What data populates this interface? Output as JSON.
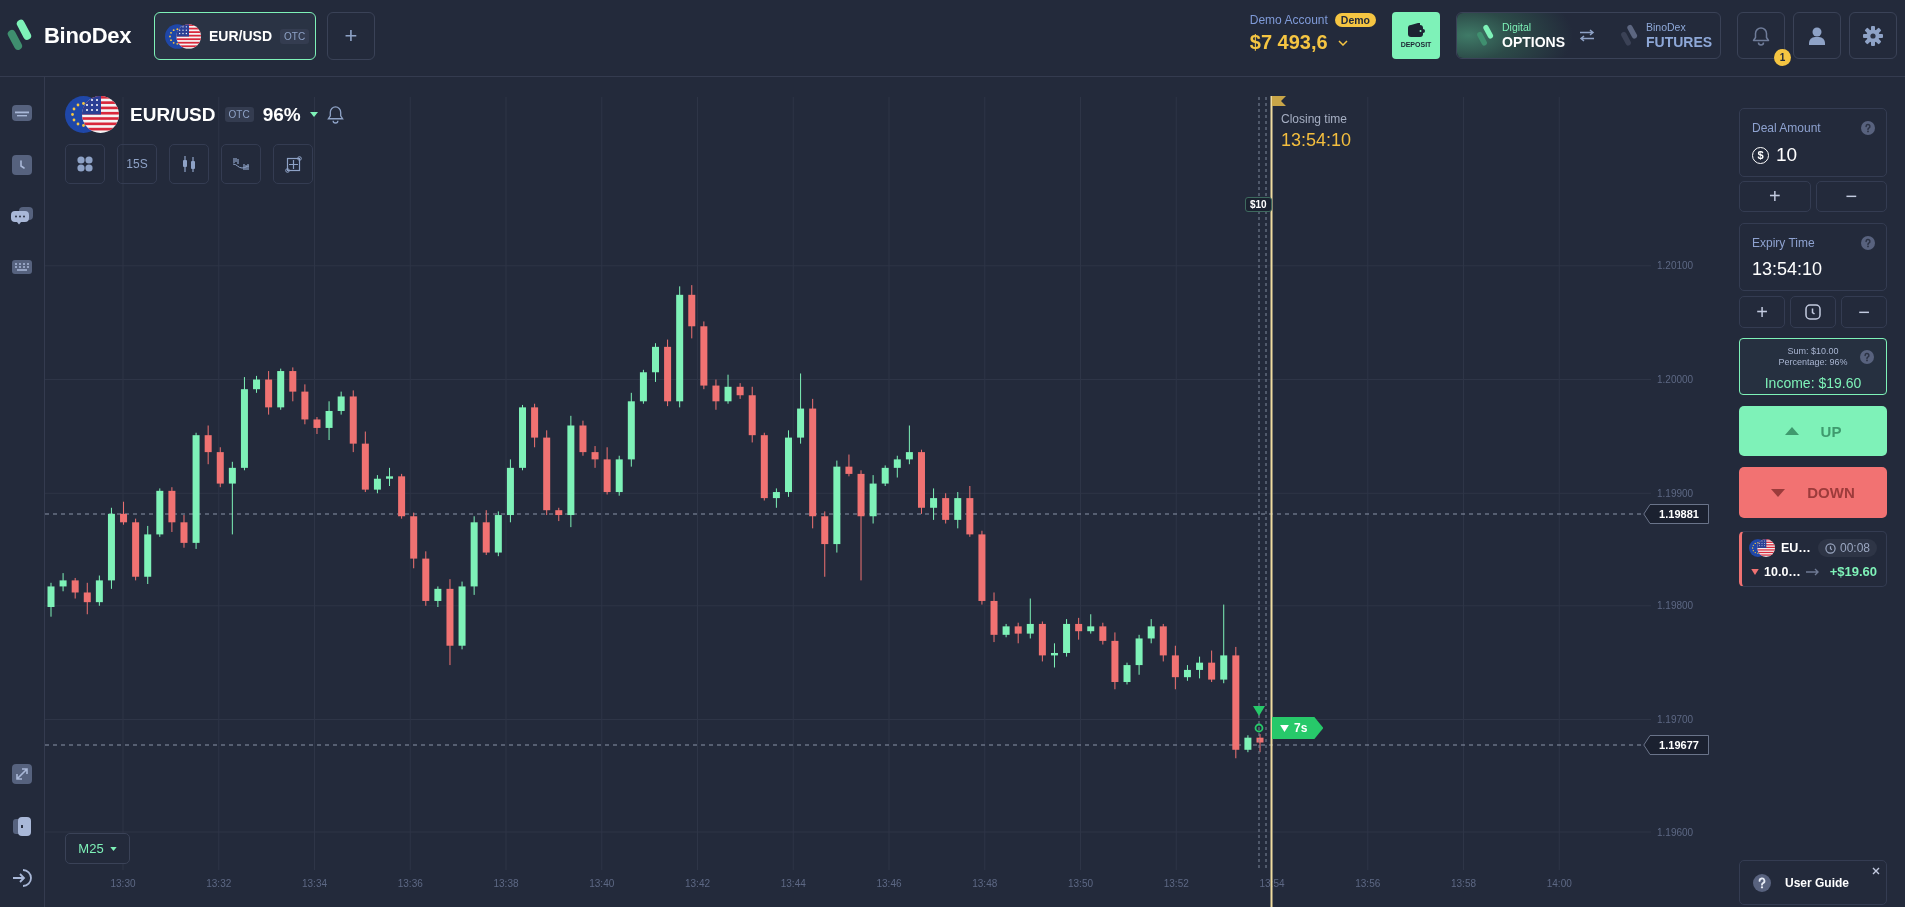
{
  "header": {
    "logo": {
      "text": "BinoDex"
    },
    "asset_tabs": [
      {
        "pair": "EUR/USD",
        "badge": "OTC",
        "selected": true
      }
    ],
    "add_button": {
      "label": "+"
    },
    "account": {
      "label": "Demo Account",
      "badge": "Demo",
      "balance": "$7 493,6"
    },
    "deposit_button": {
      "label": "DEPOSIT"
    },
    "mode_switch": [
      {
        "caption": "Digital",
        "label": "OPTIONS",
        "selected": true
      },
      {
        "caption": "BinoDex",
        "label": "FUTURES",
        "selected": false
      }
    ],
    "notifications": {
      "count": "1"
    }
  },
  "chart": {
    "asset": {
      "pair": "EUR/USD",
      "badge": "OTC",
      "payout": "96%"
    },
    "timeframe": "15S",
    "closing": {
      "label": "Closing time",
      "time": "13:54:10"
    },
    "trade_marker": {
      "amount": "$10",
      "countdown": "7s",
      "kind": "down"
    },
    "price_labels": [
      "1.19881",
      "1.19677"
    ],
    "price_ticks": [
      "1.20100",
      "1.20000",
      "1.19900",
      "1.19800",
      "1.19700",
      "1.19600"
    ],
    "time_ticks": [
      "13:30",
      "13:32",
      "13:34",
      "13:36",
      "13:38",
      "13:40",
      "13:42",
      "13:44",
      "13:46",
      "13:48",
      "13:50",
      "13:52",
      "13:54",
      "13:56",
      "13:58",
      "14:00"
    ],
    "period_button": {
      "label": "M25"
    }
  },
  "trade_panel": {
    "amount": {
      "label": "Deal Amount",
      "currency": "$",
      "value": "10"
    },
    "amount_steps": [
      "+",
      "−"
    ],
    "expiry": {
      "label": "Expiry Time",
      "value": "13:54:10"
    },
    "expiry_steps": [
      "+",
      "−"
    ],
    "summary": {
      "sum": "Sum: $10.00",
      "percentage": "Percentage: 96%",
      "income": "Income: $19.60"
    },
    "actions": [
      {
        "kind": "up",
        "label": "UP"
      },
      {
        "kind": "down",
        "label": "DOWN"
      }
    ],
    "open_trades": [
      {
        "kind": "down",
        "pair": "EU…",
        "timer": "00:08",
        "amount": "10.0…",
        "payout": "+$19.60"
      }
    ]
  },
  "user_guide": {
    "label": "User Guide"
  }
}
